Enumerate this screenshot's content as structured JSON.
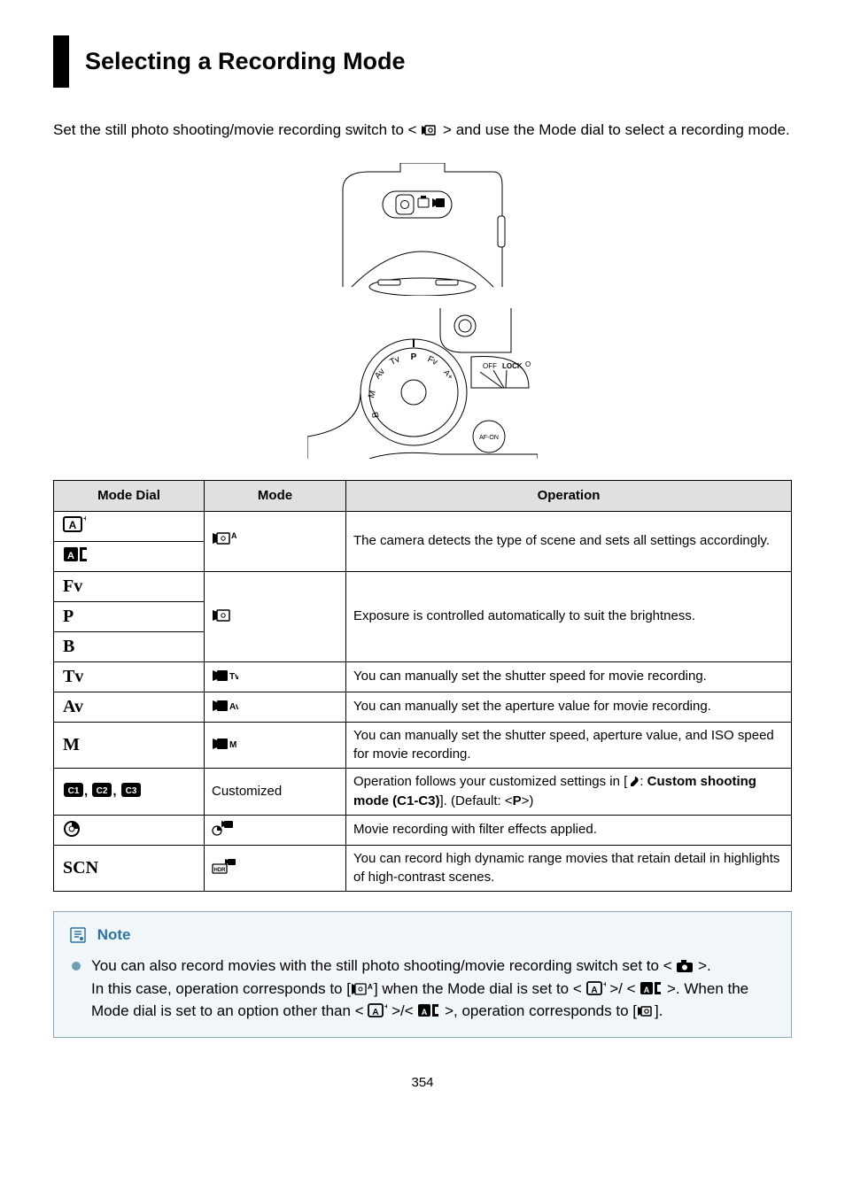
{
  "title": "Selecting a Recording Mode",
  "intro_pre": "Set the still photo shooting/movie recording switch to < ",
  "intro_post": " > and use the Mode dial to select a recording mode.",
  "table": {
    "headers": [
      "Mode Dial",
      "Mode",
      "Operation"
    ],
    "rows": [
      {
        "dial": "A+_icon",
        "mode": "movie_Aplus",
        "op": "The camera detects the type of scene and sets all settings accordingly.",
        "op_rowspan": 2
      },
      {
        "dial": "A_bracket_icon"
      },
      {
        "dial": "Fv",
        "mode": "movie_generic",
        "op": "Exposure is controlled automatically to suit the brightness.",
        "op_rowspan": 3,
        "mode_rowspan": 3
      },
      {
        "dial": "P"
      },
      {
        "dial": "B"
      },
      {
        "dial": "Tv",
        "mode": "movie_Tv",
        "op": "You can manually set the shutter speed for movie recording."
      },
      {
        "dial": "Av",
        "mode": "movie_Av",
        "op": "You can manually set the aperture value for movie recording."
      },
      {
        "dial": "M",
        "mode": "movie_M",
        "op": "You can manually set the shutter speed, aperture value, and ISO speed for movie recording."
      },
      {
        "dial": "C1C2C3",
        "mode_text": "Customized",
        "op_html": "Operation follows your customized settings in [<b>wrench-icon</b>: <b>Custom shooting mode (C1-C3)</b>]. (Default: <<b>P</b>>)"
      },
      {
        "dial": "filter_icon",
        "mode": "filter_movie",
        "op": "Movie recording with filter effects applied."
      },
      {
        "dial": "SCN",
        "mode": "hdr_movie",
        "op": "You can record high dynamic range movies that retain detail in highlights of high-contrast scenes."
      }
    ]
  },
  "note": {
    "label": "Note",
    "line1_a": "You can also record movies with the still photo shooting/movie recording switch set to < ",
    "line1_b": " >.",
    "line2_a": "In this case, operation corresponds to [",
    "line2_b": "] when the Mode dial is set to < ",
    "line2_c": " >/ < ",
    "line2_d": " >. When the Mode dial is set to an option other than < ",
    "line2_e": " >/< ",
    "line2_f": " >, operation corresponds to [",
    "line2_g": "]."
  },
  "page_number": "354"
}
